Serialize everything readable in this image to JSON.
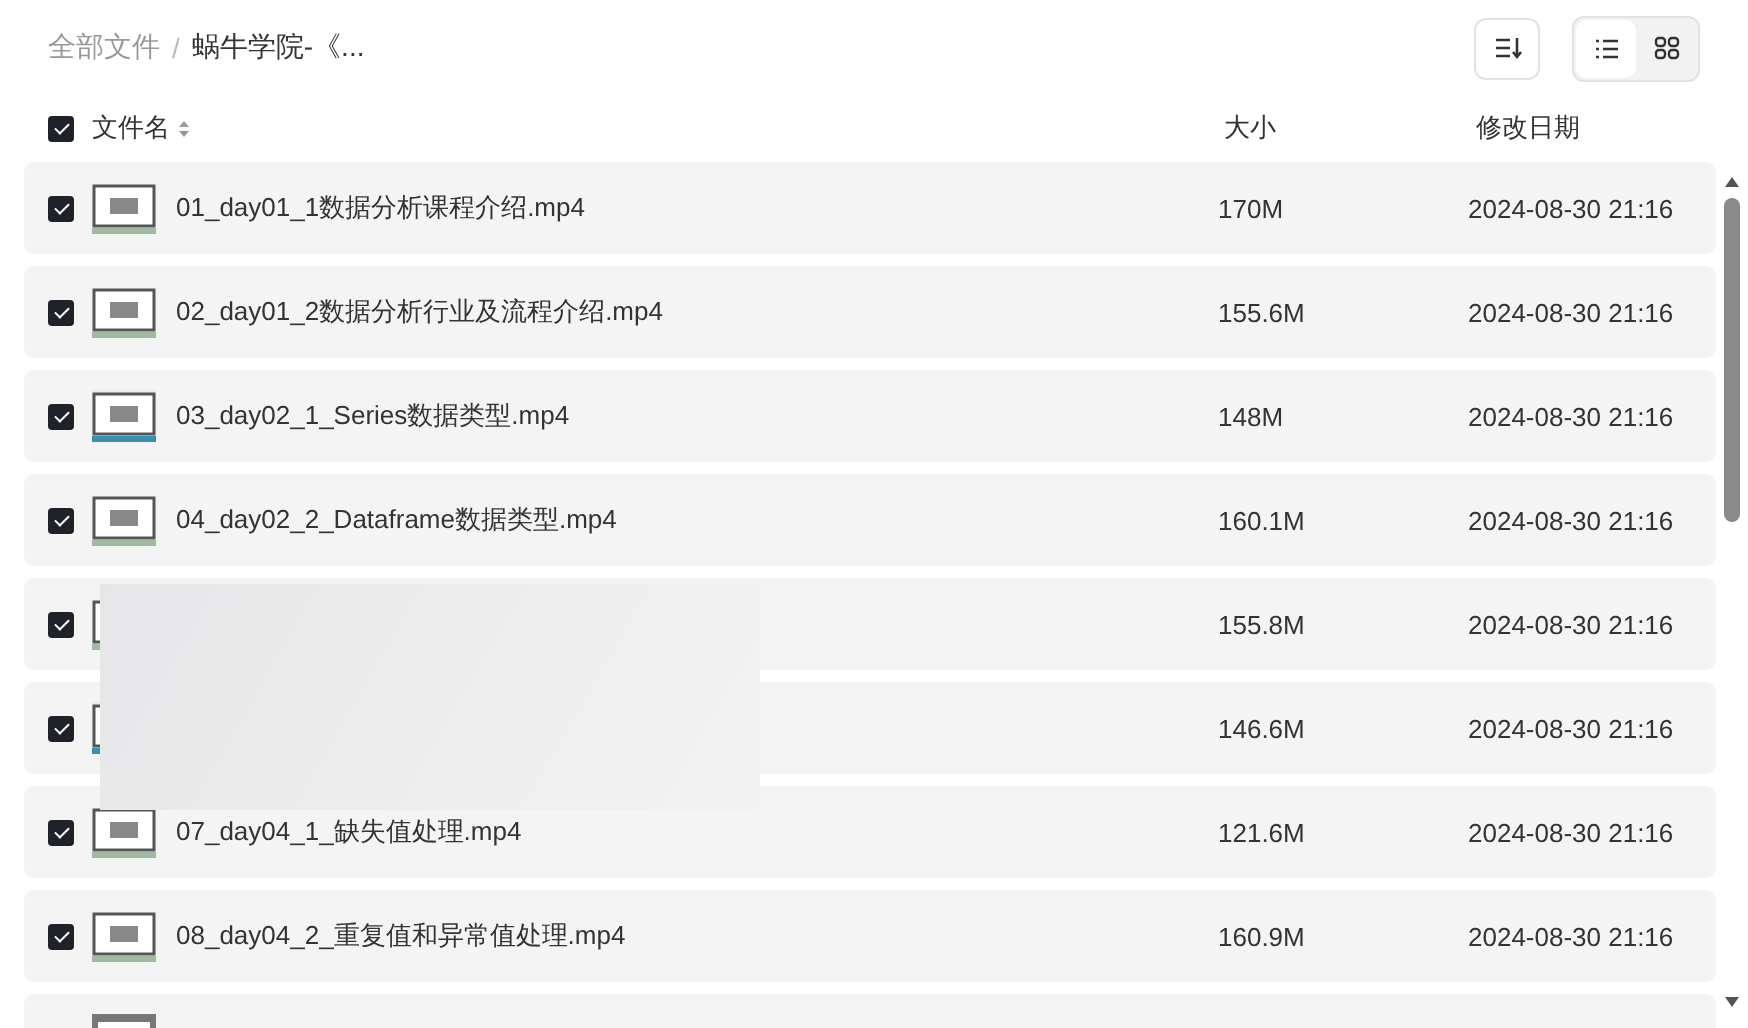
{
  "breadcrumb_separator": "/",
  "breadcrumb": [
    {
      "label": "全部文件",
      "current": false
    },
    {
      "label": "蜗牛学院-《...",
      "current": true
    }
  ],
  "view_toggle": [
    {
      "kind": "list",
      "selected": true
    },
    {
      "kind": "grid",
      "selected": false
    }
  ],
  "header": {
    "checked": true,
    "name": "文件名",
    "size": "大小",
    "date": "修改日期"
  },
  "rows": [
    {
      "checked": true,
      "name": "01_day01_1数据分析课程介绍.mp4",
      "size": "170M",
      "date": "2024-08-30 21:16"
    },
    {
      "checked": true,
      "name": "02_day01_2数据分析行业及流程介绍.mp4",
      "size": "155.6M",
      "date": "2024-08-30 21:16"
    },
    {
      "checked": true,
      "name": "03_day02_1_Series数据类型.mp4",
      "size": "148M",
      "date": "2024-08-30 21:16"
    },
    {
      "checked": true,
      "name": "04_day02_2_Dataframe数据类型.mp4",
      "size": "160.1M",
      "date": "2024-08-30 21:16"
    },
    {
      "checked": true,
      "size": "155.8M",
      "date": "2024-08-30 21:16"
    },
    {
      "checked": true,
      "size": "146.6M",
      "date": "2024-08-30 21:16"
    },
    {
      "checked": true,
      "name": "07_day04_1_缺失值处理.mp4",
      "size": "121.6M",
      "date": "2024-08-30 21:16"
    },
    {
      "checked": true,
      "name": "08_day04_2_重复值和异常值处理.mp4",
      "size": "160.9M",
      "date": "2024-08-30 21:16"
    }
  ]
}
